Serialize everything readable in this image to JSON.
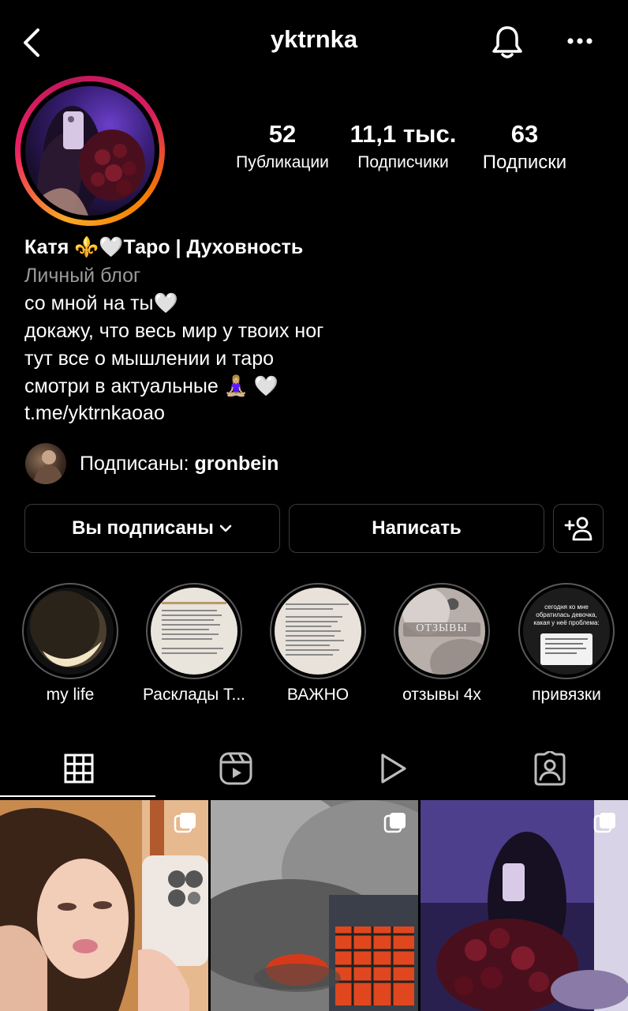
{
  "header": {
    "username": "yktrnka",
    "back_icon": "chevron-left-icon",
    "bell_icon": "bell-icon",
    "more_icon": "more-horizontal-icon"
  },
  "stats": [
    {
      "value": "52",
      "label": "Публикации"
    },
    {
      "value": "11,1 тыс.",
      "label": "Подписчики"
    },
    {
      "value": "63",
      "label": "Подписки"
    }
  ],
  "bio": {
    "name": "Катя ⚜️🤍Таро | Духовность",
    "category": "Личный блог",
    "lines": [
      "со мной на ты🤍",
      "докажу, что весь мир у твоих ног",
      "тут все о мышлении и таро",
      "смотри в актуальные 🧘🏼‍♀️ 🤍"
    ],
    "link": "t.me/yktrnkaoao"
  },
  "followed_by": {
    "prefix": "Подписаны: ",
    "user": "gronbein"
  },
  "buttons": {
    "following": "Вы подписаны",
    "message": "Написать",
    "add_person_icon": "add-person-icon"
  },
  "highlights": [
    {
      "label": "my life"
    },
    {
      "label": "Расклады Т..."
    },
    {
      "label": "ВАЖНО"
    },
    {
      "label": "отзывы 4х"
    },
    {
      "label": "привязки"
    }
  ],
  "highlight_texts": {
    "otzyvy": "ОТЗЫВЫ",
    "privyazki_text": "сегодня ко мне обратилась девочка, какая у неё проблема:"
  },
  "tabs": [
    {
      "icon": "grid-icon"
    },
    {
      "icon": "reels-icon"
    },
    {
      "icon": "play-icon"
    },
    {
      "icon": "tagged-icon"
    }
  ],
  "colors": {
    "background": "#000000",
    "border": "#3a3a3a",
    "secondary_text": "#9a9a9a"
  }
}
